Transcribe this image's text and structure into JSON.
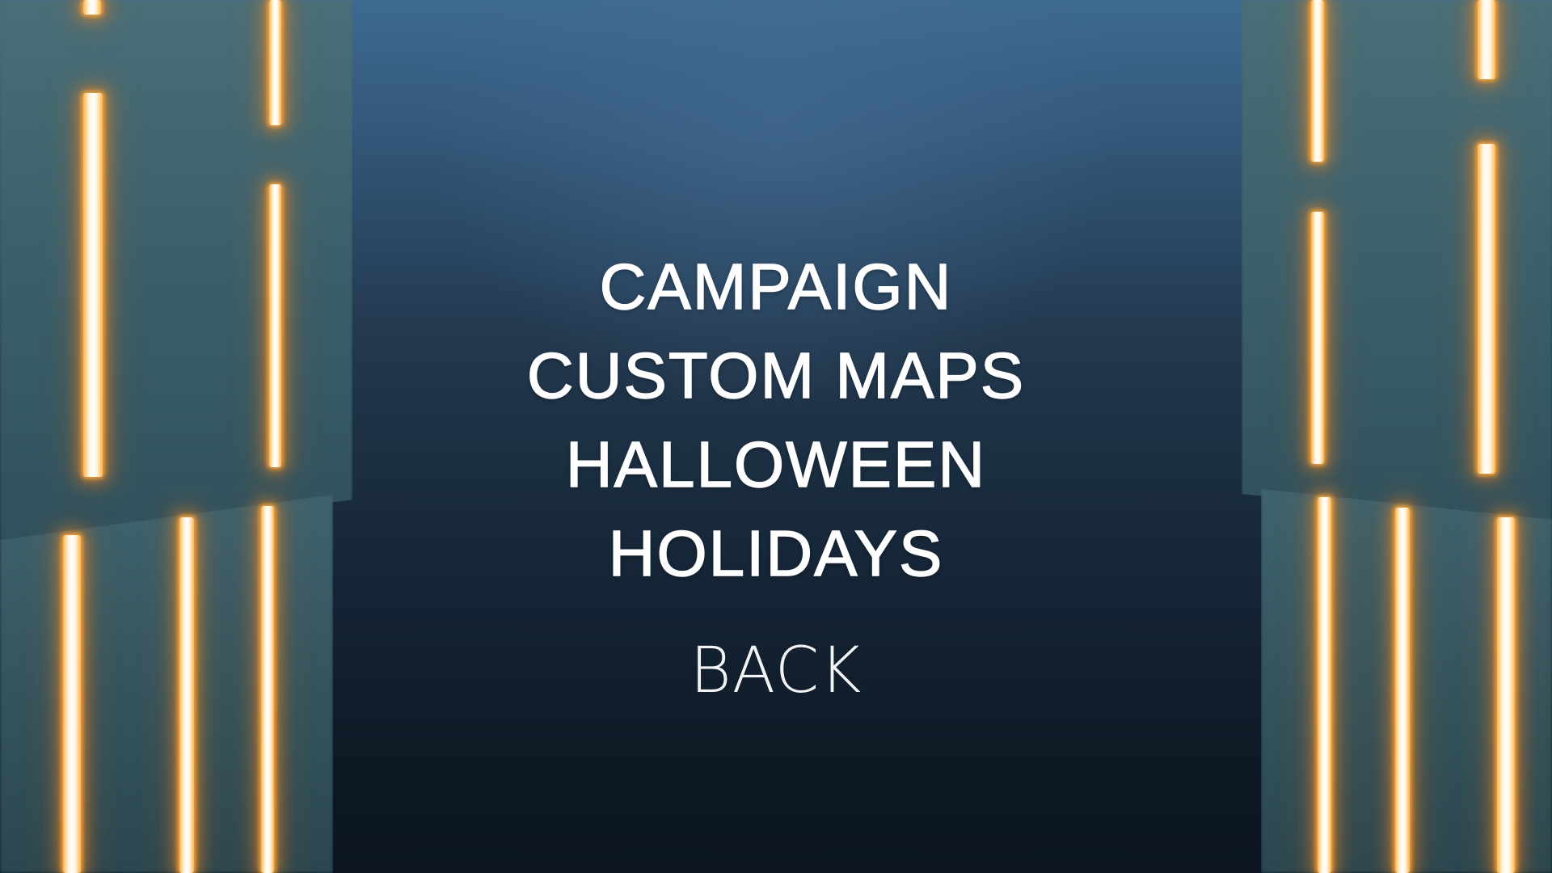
{
  "menu": {
    "items": [
      {
        "label": "CAMPAIGN"
      },
      {
        "label": "CUSTOM MAPS"
      },
      {
        "label": "HALLOWEEN"
      },
      {
        "label": "HOLIDAYS"
      }
    ],
    "back_label": "BACK"
  },
  "colors": {
    "text": "#ffffff",
    "glow": "#ffa53a",
    "background_top": "#3e6a90",
    "background_bottom": "#0c1521"
  }
}
